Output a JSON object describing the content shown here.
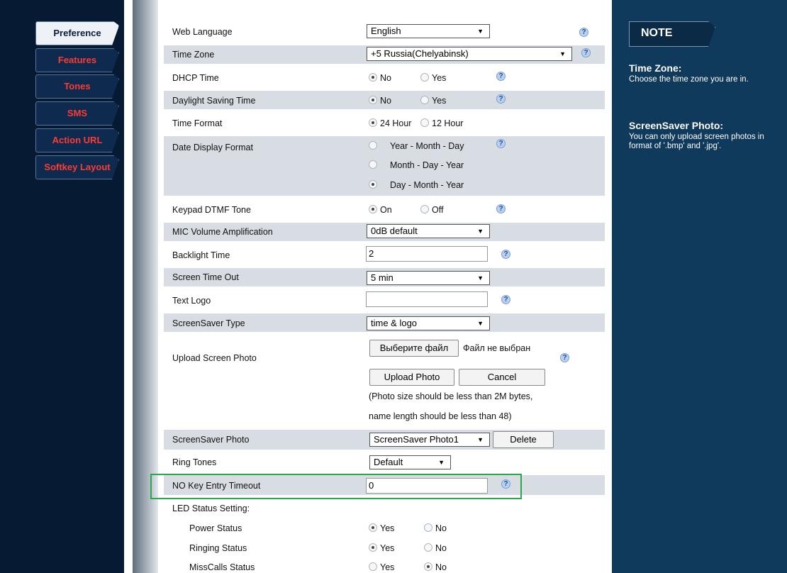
{
  "nav": {
    "items": [
      {
        "label": "Preference"
      },
      {
        "label": "Features"
      },
      {
        "label": "Tones"
      },
      {
        "label": "SMS"
      },
      {
        "label": "Action URL"
      },
      {
        "label": "Softkey Layout"
      }
    ],
    "active": "Preference"
  },
  "form": {
    "web_language": {
      "label": "Web Language",
      "value": "English"
    },
    "time_zone": {
      "label": "Time Zone",
      "value": "+5 Russia(Chelyabinsk)"
    },
    "dhcp_time": {
      "label": "DHCP Time",
      "opt1": "No",
      "opt2": "Yes",
      "selected": "No"
    },
    "daylight_saving": {
      "label": "Daylight Saving Time",
      "opt1": "No",
      "opt2": "Yes",
      "selected": "No"
    },
    "time_format": {
      "label": "Time Format",
      "opt1": "24 Hour",
      "opt2": "12 Hour",
      "selected": "24 Hour"
    },
    "date_display": {
      "label": "Date Display Format",
      "opt1": "Year - Month - Day",
      "opt2": "Month - Day - Year",
      "opt3": "Day - Month - Year",
      "selected": "Day - Month - Year"
    },
    "keypad_dtmf": {
      "label": "Keypad DTMF Tone",
      "opt1": "On",
      "opt2": "Off",
      "selected": "On"
    },
    "mic_volume": {
      "label": "MIC Volume Amplification",
      "value": "0dB default"
    },
    "backlight": {
      "label": "Backlight Time",
      "value": "2"
    },
    "screen_timeout": {
      "label": "Screen Time Out",
      "value": "5 min"
    },
    "text_logo": {
      "label": "Text Logo",
      "value": ""
    },
    "screensaver_type": {
      "label": "ScreenSaver Type",
      "value": "time & logo"
    },
    "upload_photo": {
      "label": "Upload Screen Photo",
      "choose_file": "Выберите файл",
      "no_file": "Файл не выбран",
      "upload_btn": "Upload Photo",
      "cancel_btn": "Cancel",
      "note1": "(Photo size should be less than 2M bytes,",
      "note2": "name length should be less than 48)"
    },
    "screensaver_photo": {
      "label": "ScreenSaver Photo",
      "value": "ScreenSaver Photo1",
      "delete_btn": "Delete"
    },
    "ring_tones": {
      "label": "Ring Tones",
      "value": "Default"
    },
    "no_key_timeout": {
      "label": "NO Key Entry Timeout",
      "value": "0"
    },
    "led_status": {
      "label": "LED Status Setting:"
    },
    "power_status": {
      "label": "Power Status",
      "opt1": "Yes",
      "opt2": "No",
      "selected": "Yes"
    },
    "ringing_status": {
      "label": "Ringing Status",
      "opt1": "Yes",
      "opt2": "No",
      "selected": "Yes"
    },
    "misscalls_status": {
      "label": "MissCalls Status",
      "opt1": "Yes",
      "opt2": "No",
      "selected": "No"
    }
  },
  "help_glyph": "?",
  "dropdown_arrow": "▼",
  "note_panel": {
    "tab": "NOTE",
    "h1": "Time Zone:",
    "t1": "Choose the time zone you are in.",
    "h2": "ScreenSaver Photo:",
    "t2": "You can only upload screen photos in format of '.bmp' and '.jpg'."
  },
  "colors": {
    "nav_bg": "#071a33",
    "nav_text": "#ff3b30",
    "right_bg": "#0f3a5c",
    "row_shade": "#d8dde3",
    "highlight": "#2ca84a"
  }
}
